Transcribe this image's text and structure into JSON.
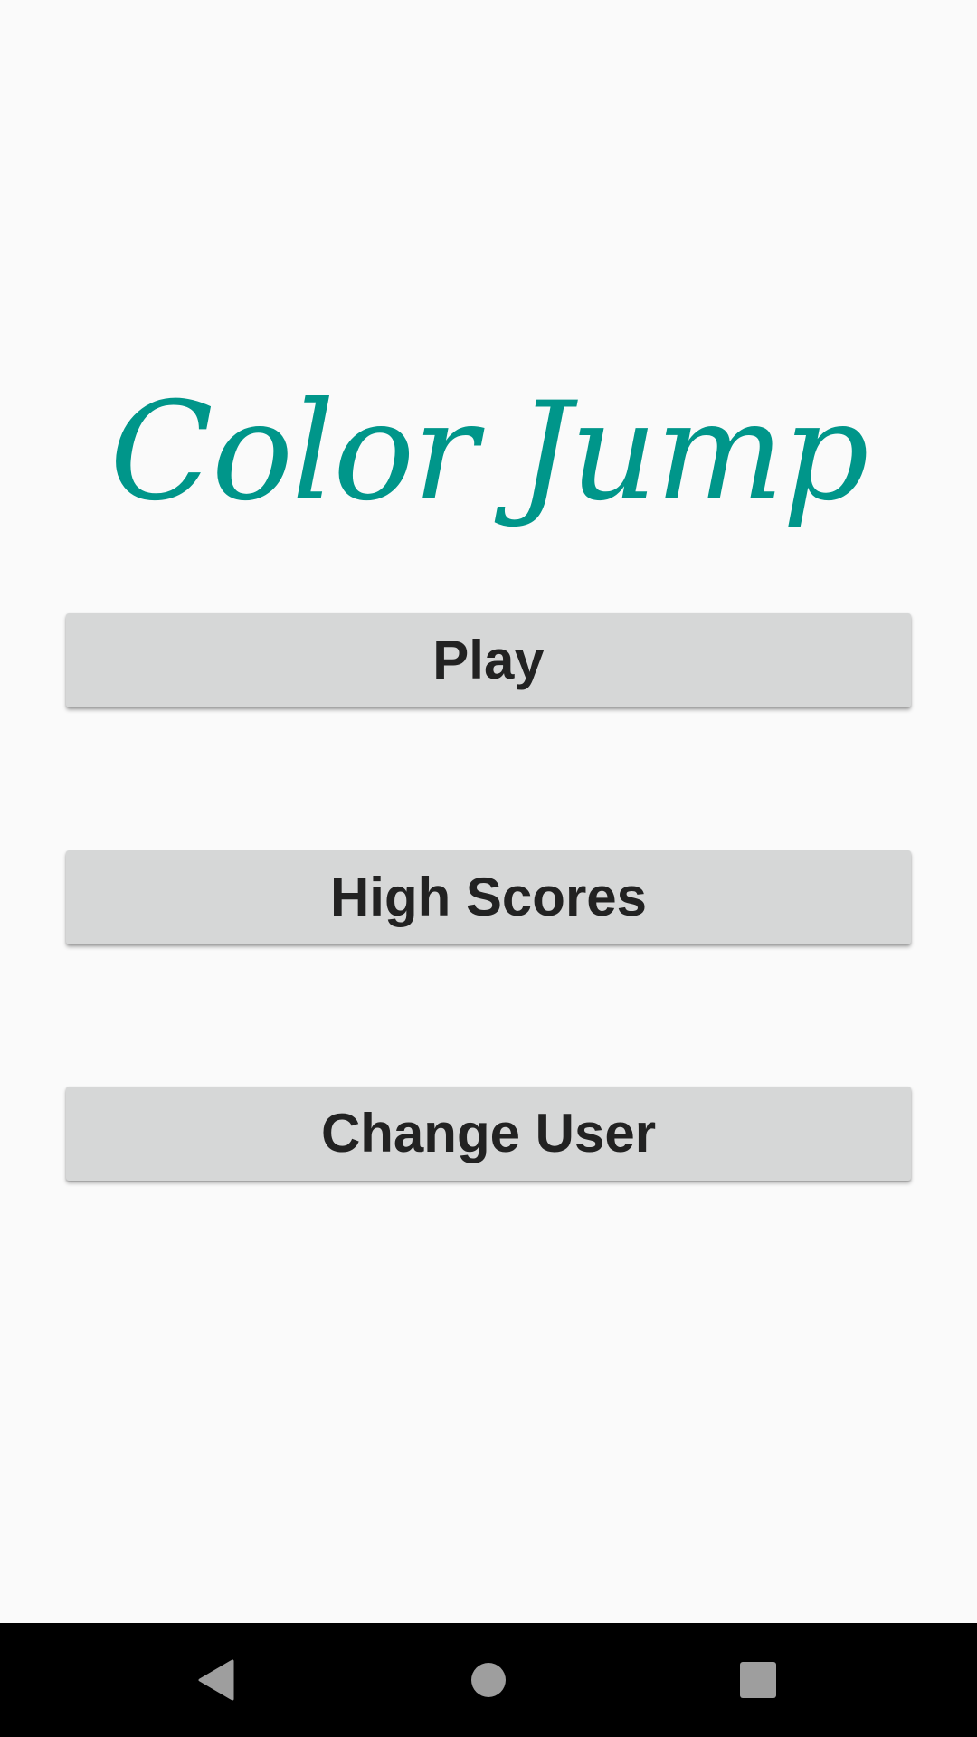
{
  "app": {
    "title": "Color Jump",
    "title_color": "#00968a"
  },
  "menu": {
    "buttons": [
      {
        "label": "Play"
      },
      {
        "label": "High Scores"
      },
      {
        "label": "Change User"
      }
    ],
    "button_color": "#d6d7d7",
    "text_color": "#222222"
  },
  "navigation_bar": {
    "icons": [
      "back-icon",
      "home-icon",
      "recents-icon"
    ],
    "icon_color": "#9e9e9e",
    "background": "#000000"
  }
}
